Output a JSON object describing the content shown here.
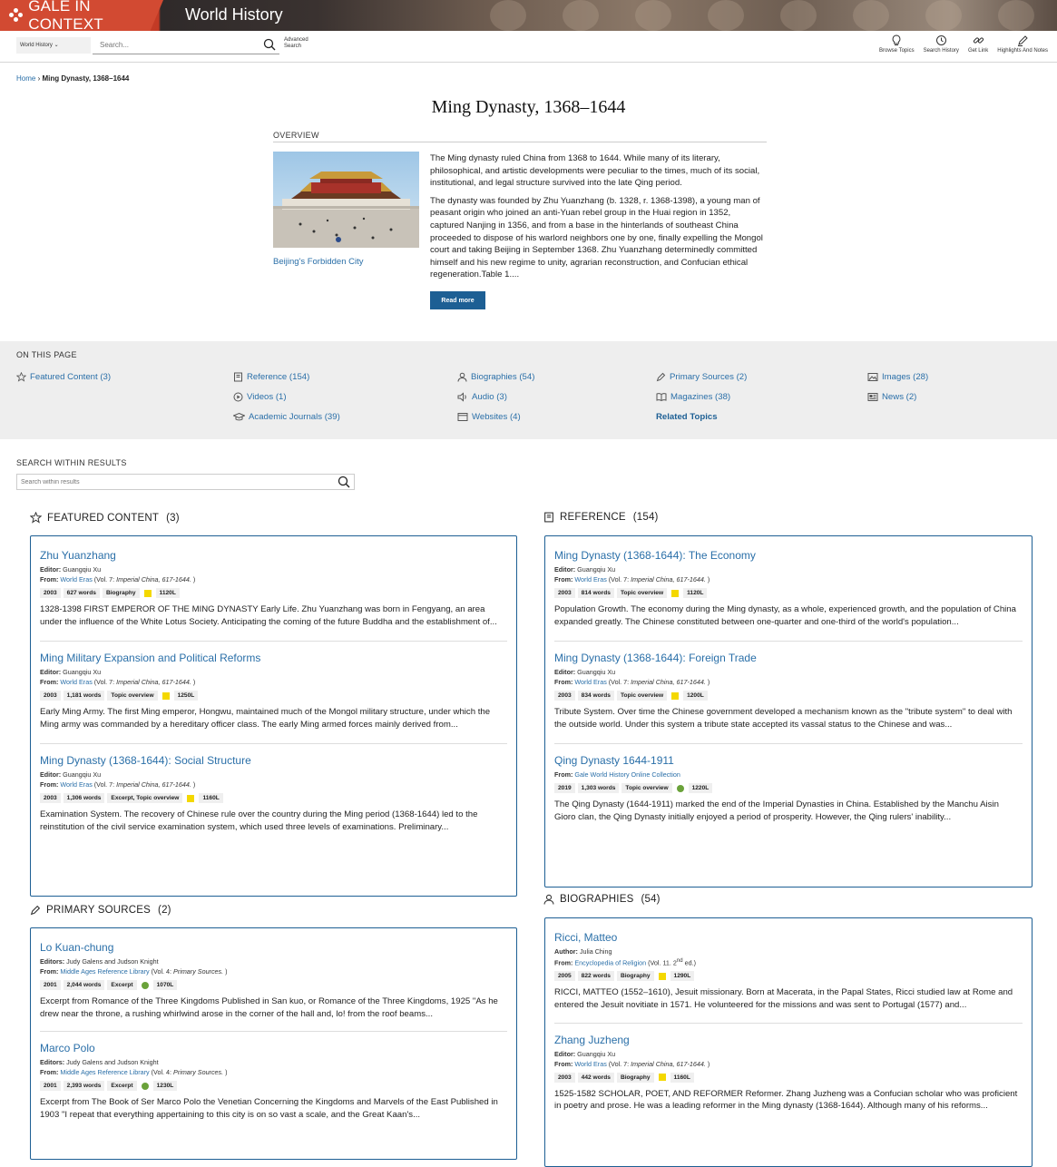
{
  "header": {
    "brand": "GALE IN CONTEXT",
    "product": "World History"
  },
  "toolbar": {
    "scope": "World History",
    "search_placeholder": "Search...",
    "advanced_search": [
      "Advanced",
      "Search"
    ],
    "tools": [
      "Browse Topics",
      "Search History",
      "Get Link",
      "Highlights And Notes"
    ]
  },
  "breadcrumb": {
    "home": "Home",
    "current": "Ming Dynasty, 1368–1644"
  },
  "page_title": "Ming Dynasty, 1368–1644",
  "overview": {
    "label": "OVERVIEW",
    "caption": "Beijing's Forbidden City",
    "paragraphs": [
      "The Ming dynasty ruled China from 1368 to 1644. While many of its literary, philosophical, and artistic developments were peculiar to the times, much of its social, institutional, and legal structure survived into the late Qing period.",
      "The dynasty was founded by Zhu Yuanzhang (b. 1328, r. 1368-1398), a young man of peasant origin who joined an anti-Yuan rebel group in the Huai region in 1352, captured Nanjing in 1356, and from a base in the hinterlands of southeast China proceeded to dispose of his warlord neighbors one by one, finally expelling the Mongol court and taking Beijing in September 1368. Zhu Yuanzhang determinedly committed himself and his new regime to unity, agrarian reconstruction, and Confucian ethical regeneration.Table 1...."
    ],
    "read_more": "Read more"
  },
  "on_this_page": {
    "label": "ON THIS PAGE",
    "items": [
      "Featured Content (3)",
      "Reference (154)",
      "Biographies (54)",
      "Primary Sources (2)",
      "Images (28)",
      "Videos (1)",
      "Audio (3)",
      "Magazines (38)",
      "News (2)",
      "Academic Journals (39)",
      "Websites (4)",
      "Related Topics"
    ]
  },
  "search_within": {
    "label": "SEARCH WITHIN RESULTS",
    "placeholder": "Search within results"
  },
  "featured": {
    "heading": "FEATURED CONTENT",
    "count": "(3)",
    "entries": [
      {
        "title": "Zhu Yuanzhang",
        "editor_label": "Editor:",
        "editor": "Guangqiu Xu",
        "from_label": "From:",
        "from_link": "World Eras",
        "from_rest_a": " (Vol. 7: ",
        "from_italic": "Imperial China, 617-1644.",
        "from_rest_b": " )",
        "year": "2003",
        "words": "627 words",
        "type": "Biography",
        "lexile": "1120L",
        "snippet": "1328-1398 FIRST EMPEROR OF THE MING DYNASTY Early Life. Zhu Yuanzhang was born in Fengyang, an area under the influence of the White Lotus Society. Anticipating the coming of the future Buddha and the establishment of..."
      },
      {
        "title": "Ming Military Expansion and Political Reforms",
        "editor_label": "Editor:",
        "editor": "Guangqiu Xu",
        "from_label": "From:",
        "from_link": "World Eras",
        "from_rest_a": " (Vol. 7: ",
        "from_italic": "Imperial China, 617-1644.",
        "from_rest_b": " )",
        "year": "2003",
        "words": "1,181 words",
        "type": "Topic overview",
        "lexile": "1250L",
        "snippet": "Early Ming Army. The first Ming emperor, Hongwu, maintained much of the Mongol military structure, under which the Ming army was commanded by a hereditary officer class. The early Ming armed forces mainly derived from..."
      },
      {
        "title": "Ming Dynasty (1368-1644): Social Structure",
        "editor_label": "Editor:",
        "editor": "Guangqiu Xu",
        "from_label": "From:",
        "from_link": "World Eras",
        "from_rest_a": " (Vol. 7: ",
        "from_italic": "Imperial China, 617-1644.",
        "from_rest_b": " )",
        "year": "2003",
        "words": "1,306 words",
        "type": "Excerpt, Topic overview",
        "lexile": "1160L",
        "snippet": "Examination System. The recovery of Chinese rule over the country during the Ming period (1368-1644) led to the reinstitution of the civil service examination system, which used three levels of examinations. Preliminary..."
      }
    ]
  },
  "primary": {
    "heading": "PRIMARY SOURCES",
    "count": "(2)",
    "entries": [
      {
        "title": "Lo Kuan-chung",
        "editor_label": "Editors:",
        "editor": "Judy Galens and Judson Knight",
        "from_label": "From:",
        "from_link": "Middle Ages Reference Library",
        "from_rest_a": " (Vol. 4: ",
        "from_italic": "Primary Sources.",
        "from_rest_b": " )",
        "year": "2001",
        "words": "2,044 words",
        "type": "Excerpt",
        "lexile": "1070L",
        "snippet": "Excerpt from Romance of the Three Kingdoms Published in San kuo, or Romance of the Three Kingdoms, 1925 \"As he drew near the throne, a rushing whirlwind arose in the corner of the hall and, lo! from the roof beams..."
      },
      {
        "title": "Marco Polo",
        "editor_label": "Editors:",
        "editor": "Judy Galens and Judson Knight",
        "from_label": "From:",
        "from_link": "Middle Ages Reference Library",
        "from_rest_a": " (Vol. 4: ",
        "from_italic": "Primary Sources.",
        "from_rest_b": " )",
        "year": "2001",
        "words": "2,393 words",
        "type": "Excerpt",
        "lexile": "1230L",
        "snippet": "Excerpt from The Book of Ser Marco Polo the Venetian Concerning the Kingdoms and Marvels of the East Published in 1903 \"I repeat that everything appertaining to this city is on so vast a scale, and the Great Kaan's..."
      }
    ]
  },
  "reference": {
    "heading": "REFERENCE",
    "count": "(154)",
    "entries": [
      {
        "title": "Ming Dynasty (1368-1644): The Economy",
        "editor_label": "Editor:",
        "editor": "Guangqiu Xu",
        "from_label": "From:",
        "from_link": "World Eras",
        "from_rest_a": " (Vol. 7: ",
        "from_italic": "Imperial China, 617-1644.",
        "from_rest_b": " )",
        "year": "2003",
        "words": "814 words",
        "type": "Topic overview",
        "lexile": "1120L",
        "snippet": "Population Growth. The economy during the Ming dynasty, as a whole, experienced growth, and the population of China expanded greatly. The Chinese constituted between one-quarter and one-third of the world's population..."
      },
      {
        "title": "Ming Dynasty (1368-1644): Foreign Trade",
        "editor_label": "Editor:",
        "editor": "Guangqiu Xu",
        "from_label": "From:",
        "from_link": "World Eras",
        "from_rest_a": " (Vol. 7: ",
        "from_italic": "Imperial China, 617-1644.",
        "from_rest_b": " )",
        "year": "2003",
        "words": "834 words",
        "type": "Topic overview",
        "lexile": "1200L",
        "snippet": "Tribute System. Over time the Chinese government developed a mechanism known as the \"tribute system\" to deal with the outside world. Under this system a tribute state accepted its vassal status to the Chinese and was..."
      },
      {
        "title": "Qing Dynasty 1644-1911",
        "from_label": "From:",
        "from_link": "Gale World History Online Collection",
        "year": "2019",
        "words": "1,303 words",
        "type": "Topic overview",
        "lexile": "1220L",
        "snippet": "The Qing Dynasty (1644-1911) marked the end of the Imperial Dynasties in China. Established by the Manchu Aisin Gioro clan, the Qing Dynasty initially enjoyed a period of prosperity. However, the Qing rulers' inability..."
      }
    ]
  },
  "biographies": {
    "heading": "BIOGRAPHIES",
    "count": "(54)",
    "entries": [
      {
        "title": "Ricci, Matteo",
        "editor_label": "Author:",
        "editor": "Julia Ching",
        "from_label": "From:",
        "from_link": "Encyclopedia of Religion",
        "from_rest_a": " (Vol. 11. 2",
        "from_sup": "nd",
        "from_rest_b": " ed.)",
        "year": "2005",
        "words": "822 words",
        "type": "Biography",
        "lexile": "1290L",
        "snippet": "RICCI, MATTEO (1552–1610), Jesuit missionary. Born at Macerata, in the Papal States, Ricci studied law at Rome and entered the Jesuit novitiate in 1571. He volunteered for the missions and was sent to Portugal (1577) and..."
      },
      {
        "title": "Zhang Juzheng",
        "editor_label": "Editor:",
        "editor": "Guangqiu Xu",
        "from_label": "From:",
        "from_link": "World Eras",
        "from_rest_a": " (Vol. 7: ",
        "from_italic": "Imperial China, 617-1644.",
        "from_rest_b": " )",
        "year": "2003",
        "words": "442 words",
        "type": "Biography",
        "lexile": "1160L",
        "snippet": "1525-1582 SCHOLAR, POET, AND REFORMER Reformer. Zhang Juzheng was a Confucian scholar who was proficient in poetry and prose. He was a leading reformer in the Ming dynasty (1368-1644). Although many of his reforms..."
      }
    ]
  },
  "colors": {
    "brand_red": "#d24a32",
    "link": "#2a6fa8",
    "button": "#1d5f94",
    "lexile_yellow": "#f4d800",
    "lexile_green": "#6aa23a"
  }
}
